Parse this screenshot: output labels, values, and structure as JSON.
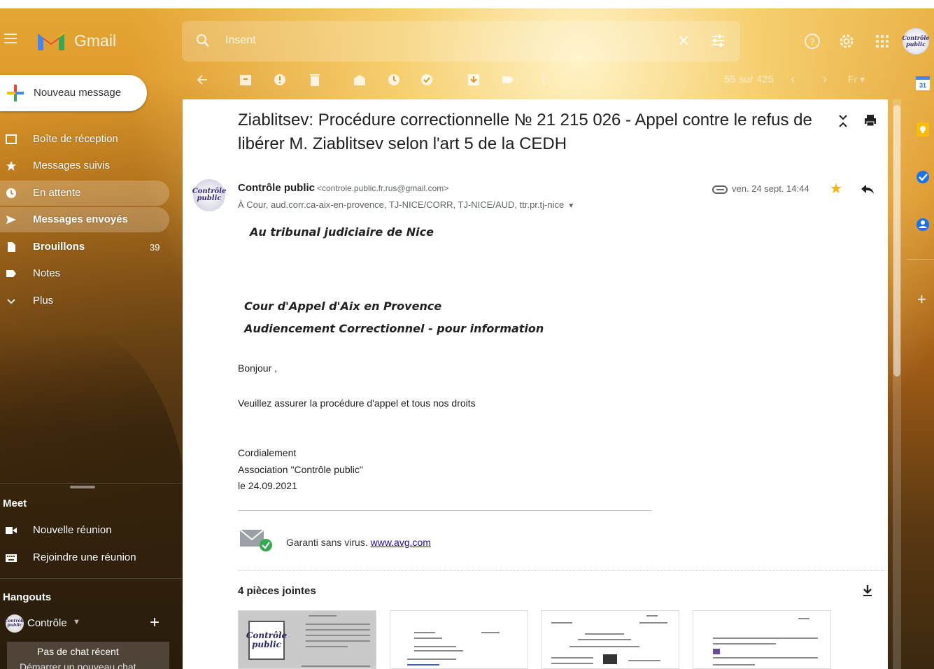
{
  "header": {
    "app_name": "Gmail",
    "search_value": "Insent",
    "account_avatar_text": "Contrôle public"
  },
  "sidebar": {
    "compose_label": "Nouveau message",
    "items": [
      {
        "label": "Boîte de réception",
        "icon": "inbox-icon"
      },
      {
        "label": "Messages suivis",
        "icon": "star-icon"
      },
      {
        "label": "En attente",
        "icon": "clock-icon"
      },
      {
        "label": "Messages envoyés",
        "icon": "send-icon"
      },
      {
        "label": "Brouillons",
        "icon": "draft-icon",
        "count": "39"
      },
      {
        "label": "Notes",
        "icon": "label-icon"
      },
      {
        "label": "Plus",
        "icon": "chevron-down-icon"
      }
    ],
    "meet": {
      "title": "Meet",
      "new_meeting": "Nouvelle réunion",
      "join_meeting": "Rejoindre une réunion"
    },
    "hangouts": {
      "title": "Hangouts",
      "user": "Contrôle",
      "no_recent": "Pas de chat récent",
      "start_new": "Démarrer un nouveau chat"
    }
  },
  "toolbar": {
    "pager_text": "55 sur 425",
    "lang": "Fr"
  },
  "message": {
    "subject": "Ziablitsev: Procédure correctionnelle № 21 215 026 - Appel contre le refus de libérer M. Ziablitsev selon l'art 5 de la CEDH",
    "sender_name": "Contrôle public",
    "sender_email": "<controle.public.fr.rus@gmail.com>",
    "recipients": "À Cour, aud.corr.ca-aix-en-provence, TJ-NICE/CORR, TJ-NICE/AUD, ttr.pr.tj-nice",
    "date": "ven. 24 sept. 14:44",
    "sender_avatar_text": "Contrôle public",
    "body": {
      "line1": "Au tribunal  judiciaire de Nice",
      "line2": "Cour d'Appel d'Aix en Provence",
      "line3": "Audiencement Correctionnel   - pour information",
      "greeting": "Bonjour ,",
      "request": "Veuillez  assurer la procédure d'appel et tous nos droits",
      "closing": "Cordialement",
      "association": "Association \"Contrôle public\"",
      "date_line": "le 24.09.2021"
    },
    "avg_text": "Garanti sans virus.",
    "avg_link": "www.avg.com",
    "attachments_title": "4 pièces jointes",
    "attachment_thumb_logo": "Contrôle public"
  },
  "colors": {
    "accent_star": "#f4b400",
    "link": "#1a0dab"
  }
}
